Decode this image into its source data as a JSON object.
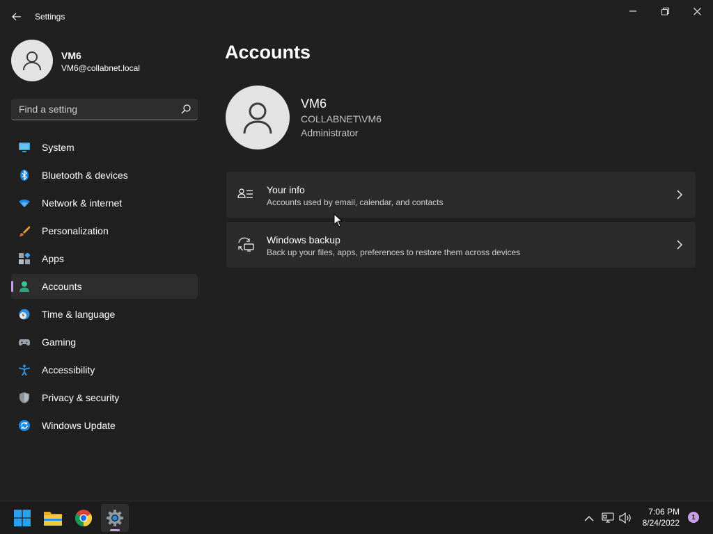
{
  "window": {
    "title": "Settings"
  },
  "profile": {
    "name": "VM6",
    "email": "VM6@collabnet.local"
  },
  "search": {
    "placeholder": "Find a setting"
  },
  "sidebar": {
    "items": [
      {
        "label": "System",
        "icon": "display-icon"
      },
      {
        "label": "Bluetooth & devices",
        "icon": "bluetooth-icon"
      },
      {
        "label": "Network & internet",
        "icon": "wifi-icon"
      },
      {
        "label": "Personalization",
        "icon": "brush-icon"
      },
      {
        "label": "Apps",
        "icon": "apps-icon"
      },
      {
        "label": "Accounts",
        "icon": "person-icon",
        "selected": true
      },
      {
        "label": "Time & language",
        "icon": "globe-clock-icon"
      },
      {
        "label": "Gaming",
        "icon": "gamepad-icon"
      },
      {
        "label": "Accessibility",
        "icon": "accessibility-icon"
      },
      {
        "label": "Privacy & security",
        "icon": "shield-icon"
      },
      {
        "label": "Windows Update",
        "icon": "update-icon"
      }
    ]
  },
  "main": {
    "page_title": "Accounts",
    "account": {
      "name": "VM6",
      "domain": "COLLABNET\\VM6",
      "role": "Administrator"
    },
    "cards": [
      {
        "title": "Your info",
        "subtitle": "Accounts used by email, calendar, and contacts",
        "icon": "contact-card-icon"
      },
      {
        "title": "Windows backup",
        "subtitle": "Back up your files, apps, preferences to restore them across devices",
        "icon": "backup-icon"
      }
    ]
  },
  "taskbar": {
    "apps": [
      "start-icon",
      "file-explorer-icon",
      "chrome-icon",
      "settings-icon"
    ],
    "clock": {
      "time": "7:06 PM",
      "date": "8/24/2022"
    },
    "notification_count": "1"
  },
  "colors": {
    "background": "#202020",
    "accent": "#c8a0e6",
    "card": "#2b2b2b"
  }
}
